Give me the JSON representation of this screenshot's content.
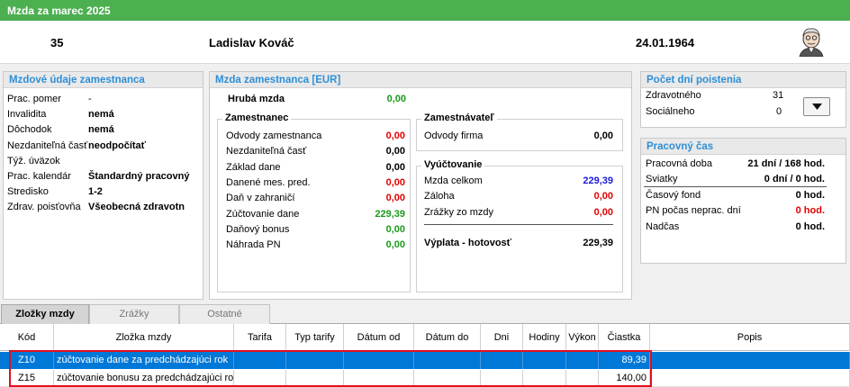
{
  "title": "Mzda za marec 2025",
  "header": {
    "id": "35",
    "name": "Ladislav Kováč",
    "birth_date": "24.01.1964"
  },
  "employee_panel": {
    "title": "Mzdové údaje zamestnanca",
    "rows": [
      {
        "label": "Prac. pomer",
        "value": "-"
      },
      {
        "label": "Invalidita",
        "value": "nemá"
      },
      {
        "label": "Dôchodok",
        "value": "nemá"
      },
      {
        "label": "Nezdaniteľná časť",
        "value": "neodpočítať"
      },
      {
        "label": "Týž. úväzok",
        "value": ""
      },
      {
        "label": "Prac. kalendár",
        "value": "Štandardný pracovný"
      },
      {
        "label": "Stredisko",
        "value": "1-2"
      },
      {
        "label": "Zdrav. poisťovňa",
        "value": "Všeobecná zdravotn"
      }
    ]
  },
  "wage_panel": {
    "title": "Mzda zamestnanca [EUR]",
    "gross_label": "Hrubá mzda",
    "gross_value": "0,00",
    "employee_group": {
      "title": "Zamestnanec",
      "rows": [
        {
          "label": "Odvody zamestnanca",
          "value": "0,00",
          "color": "#e00000"
        },
        {
          "label": "Nezdaniteľná časť",
          "value": "0,00",
          "color": "#000000"
        },
        {
          "label": "Základ dane",
          "value": "0,00",
          "color": "#000000"
        },
        {
          "label": "Danené mes. pred.",
          "value": "0,00",
          "color": "#e00000"
        },
        {
          "label": "Daň v zahraničí",
          "value": "0,00",
          "color": "#e00000"
        },
        {
          "label": "Zúčtovanie dane",
          "value": "229,39",
          "color": "#1a9a1a"
        },
        {
          "label": "Daňový bonus",
          "value": "0,00",
          "color": "#1a9a1a"
        },
        {
          "label": "Náhrada PN",
          "value": "0,00",
          "color": "#1a9a1a"
        }
      ]
    },
    "employer_group": {
      "title": "Zamestnávateľ",
      "rows": [
        {
          "label": "Odvody firma",
          "value": "0,00",
          "color": "#000000"
        }
      ]
    },
    "settlement_group": {
      "title": "Vyúčtovanie",
      "rows": [
        {
          "label": "Mzda celkom",
          "value": "229,39",
          "color": "#1a1ad6"
        },
        {
          "label": "Záloha",
          "value": "0,00",
          "color": "#e00000"
        },
        {
          "label": "Zrážky zo mzdy",
          "value": "0,00",
          "color": "#e00000"
        }
      ],
      "payout_label": "Výplata - hotovosť",
      "payout_value": "229,39"
    }
  },
  "insurance_panel": {
    "title": "Počet dní poistenia",
    "rows": [
      {
        "label": "Zdravotného",
        "value": "31"
      },
      {
        "label": "Sociálneho",
        "value": "0"
      }
    ]
  },
  "worktime_panel": {
    "title": "Pracovný čas",
    "rows": [
      {
        "label": "Pracovná doba",
        "value": "21 dní / 168 hod.",
        "color": "#000000"
      },
      {
        "label": "Sviatky",
        "value": "0 dní / 0 hod.",
        "color": "#000000"
      },
      {
        "label": "Časový fond",
        "value": "0 hod.",
        "color": "#000000"
      },
      {
        "label": "PN počas neprac. dní",
        "value": "0 hod.",
        "color": "#e00000"
      },
      {
        "label": "Nadčas",
        "value": "0 hod.",
        "color": "#000000"
      }
    ]
  },
  "tabs": [
    {
      "label": "Zložky mzdy",
      "active": true
    },
    {
      "label": "Zrážky",
      "active": false
    },
    {
      "label": "Ostatné",
      "active": false
    }
  ],
  "table": {
    "columns": [
      "Kód",
      "Zložka mzdy",
      "Tarifa",
      "Typ tarify",
      "Dátum od",
      "Dátum do",
      "Dni",
      "Hodiny",
      "Výkon",
      "Čiastka",
      "Popis"
    ],
    "rows": [
      {
        "code": "Z10",
        "name": "zúčtovanie dane za predchádzajúci rok",
        "amount": "89,39",
        "selected": true
      },
      {
        "code": "Z15",
        "name": "zúčtovanie bonusu za predchádzajúci rok",
        "amount": "140,00",
        "selected": false
      }
    ]
  }
}
